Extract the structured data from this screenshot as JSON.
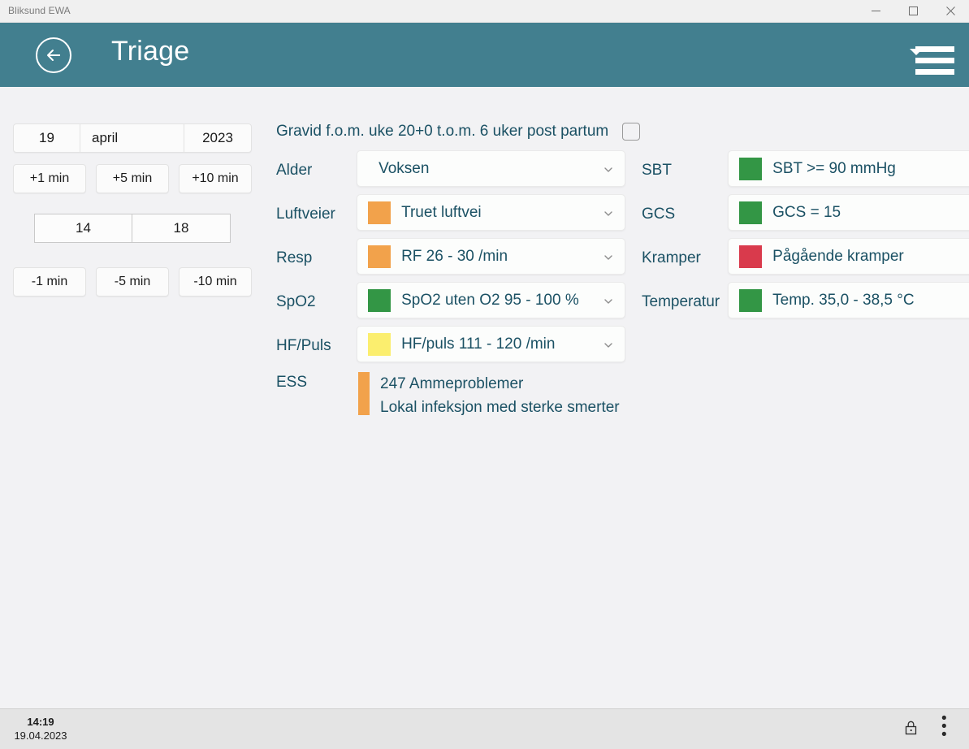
{
  "window": {
    "app_title": "Bliksund EWA",
    "minimize_label": "Minimize",
    "maximize_label": "Maximize",
    "close_label": "Close"
  },
  "header": {
    "title": "Triage",
    "back_label": "Back",
    "menu_label": "Menu",
    "accent_color": "#427f8f"
  },
  "timepad": {
    "date": {
      "day": "19",
      "month": "april",
      "year": "2023"
    },
    "plus_buttons": [
      "+1 min",
      "+5 min",
      "+10 min"
    ],
    "time": {
      "hour": "14",
      "minute": "18"
    },
    "minus_buttons": [
      "-1 min",
      "-5 min",
      "-10 min"
    ]
  },
  "gravid": {
    "label": "Gravid f.o.m. uke 20+0 t.o.m. 6 uker post partum",
    "checked": false
  },
  "fields_left": [
    {
      "label": "Alder",
      "value": "Voksen",
      "swatch": null
    },
    {
      "label": "Luftveier",
      "value": "Truet luftvei",
      "swatch": "#f2a24b"
    },
    {
      "label": "Resp",
      "value": "RF 26 -  30 /min",
      "swatch": "#f2a24b"
    },
    {
      "label": "SpO2",
      "value": "SpO2 uten O2 95 -  100 %",
      "swatch": "#339645"
    },
    {
      "label": "HF/Puls",
      "value": "HF/puls 111 -  120 /min",
      "swatch": "#fbee6e"
    }
  ],
  "fields_right": [
    {
      "label": "SBT",
      "value": "SBT >= 90 mmHg",
      "swatch": "#339645"
    },
    {
      "label": "GCS",
      "value": "GCS = 15",
      "swatch": "#339645"
    },
    {
      "label": "Kramper",
      "value": "Pågående kramper",
      "swatch": "#d93a4c"
    },
    {
      "label": "Temperatur",
      "value": "Temp. 35,0 -  38,5 °C",
      "swatch": "#339645"
    }
  ],
  "ess": {
    "label": "ESS",
    "swatch": "#f2a24b",
    "line1": "247 Ammeproblemer",
    "line2": "Lokal infeksjon med sterke smerter"
  },
  "taskbar": {
    "time": "14:19",
    "date": "19.04.2023",
    "lock_label": "Lock",
    "overflow_label": "Show hidden icons",
    "dots": "• • •"
  },
  "colors": {
    "text_teal": "#1b5164",
    "header_teal": "#427f8f",
    "orange": "#f2a24b",
    "green": "#339645",
    "yellow": "#fbee6e",
    "red": "#d93a4c"
  }
}
